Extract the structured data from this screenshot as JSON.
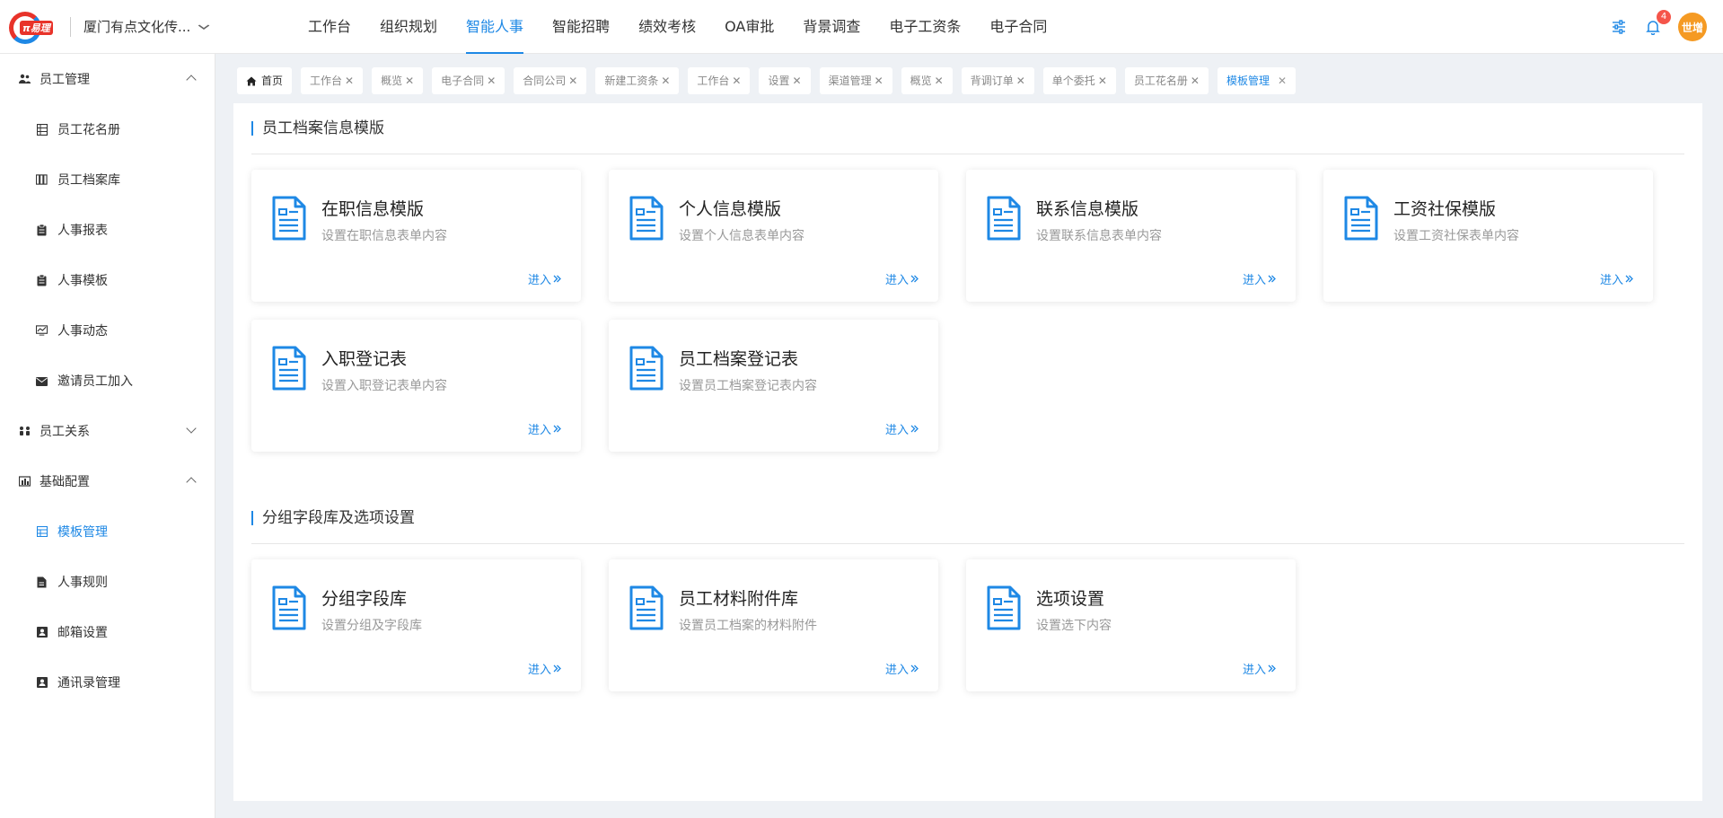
{
  "header": {
    "logo_text": "π易理",
    "company": "厦门有点文化传...",
    "nav": [
      "工作台",
      "组织规划",
      "智能人事",
      "智能招聘",
      "绩效考核",
      "OA审批",
      "背景调查",
      "电子工资条",
      "电子合同"
    ],
    "nav_active": "智能人事",
    "notification_count": "4",
    "avatar_text": "世增",
    "accent_color": "#1e88e5"
  },
  "sidebar": {
    "groups": [
      {
        "label": "员工管理",
        "icon": "users-icon",
        "expanded": true,
        "items": [
          {
            "label": "员工花名册",
            "icon": "table-icon"
          },
          {
            "label": "员工档案库",
            "icon": "archive-icon"
          },
          {
            "label": "人事报表",
            "icon": "clipboard-icon"
          },
          {
            "label": "人事模板",
            "icon": "clipboard-icon"
          },
          {
            "label": "人事动态",
            "icon": "chart-icon"
          },
          {
            "label": "邀请员工加入",
            "icon": "envelope-icon"
          }
        ]
      },
      {
        "label": "员工关系",
        "icon": "relation-icon",
        "expanded": false,
        "items": []
      },
      {
        "label": "基础配置",
        "icon": "bar-chart-icon",
        "expanded": true,
        "items": [
          {
            "label": "模板管理",
            "icon": "grid-icon",
            "active": true
          },
          {
            "label": "人事规则",
            "icon": "file-icon"
          },
          {
            "label": "邮箱设置",
            "icon": "contact-icon"
          },
          {
            "label": "通讯录管理",
            "icon": "contact-icon"
          }
        ]
      }
    ]
  },
  "tabs": [
    {
      "label": "首页",
      "home": true
    },
    {
      "label": "工作台"
    },
    {
      "label": "概览"
    },
    {
      "label": "电子合同"
    },
    {
      "label": "合同公司"
    },
    {
      "label": "新建工资条"
    },
    {
      "label": "工作台"
    },
    {
      "label": "设置"
    },
    {
      "label": "渠道管理"
    },
    {
      "label": "概览"
    },
    {
      "label": "背调订单"
    },
    {
      "label": "单个委托"
    },
    {
      "label": "员工花名册"
    },
    {
      "label": "模板管理",
      "active": true
    }
  ],
  "sections": [
    {
      "title": "员工档案信息模版",
      "cards": [
        {
          "title": "在职信息模版",
          "desc": "设置在职信息表单内容",
          "link": "进入"
        },
        {
          "title": "个人信息模版",
          "desc": "设置个人信息表单内容",
          "link": "进入"
        },
        {
          "title": "联系信息模版",
          "desc": "设置联系信息表单内容",
          "link": "进入"
        },
        {
          "title": "工资社保模版",
          "desc": "设置工资社保表单内容",
          "link": "进入"
        },
        {
          "title": "入职登记表",
          "desc": "设置入职登记表单内容",
          "link": "进入"
        },
        {
          "title": "员工档案登记表",
          "desc": "设置员工档案登记表内容",
          "link": "进入"
        }
      ]
    },
    {
      "title": "分组字段库及选项设置",
      "cards": [
        {
          "title": "分组字段库",
          "desc": "设置分组及字段库",
          "link": "进入"
        },
        {
          "title": "员工材料附件库",
          "desc": "设置员工档案的材料附件",
          "link": "进入"
        },
        {
          "title": "选项设置",
          "desc": "设置选下内容",
          "link": "进入"
        }
      ]
    }
  ]
}
